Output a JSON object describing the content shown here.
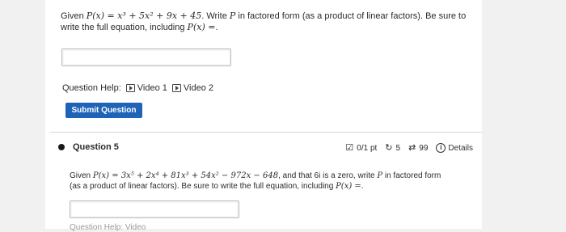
{
  "question4": {
    "line1_prefix": "Given ",
    "line1_func": "P(x)",
    "line1_eq": " = x³ + 5x² + 9x + 45",
    "line1_rest": ". Write ",
    "line1_var": "P",
    "line1_tail": " in factored form (as a product of linear factors). Be sure to",
    "line2_prefix": "write the full equation, including ",
    "line2_func": "P(x) =",
    "line2_end": ".",
    "help_label": "Question Help:",
    "video1": "Video 1",
    "video2": "Video 2",
    "submit_label": "Submit Question"
  },
  "question5": {
    "title": "Question 5",
    "score": "0/1 pt",
    "retries": "5",
    "attempts": "99",
    "details": "Details",
    "line1_prefix": "Given ",
    "line1_func": "P(x)",
    "line1_eq": " = 3x⁵ + 2x⁴ + 81x³ + 54x² − 972x − 648",
    "line1_rest": ", and that 6i is a zero, write ",
    "line1_var": "P",
    "line1_tail": " in factored form",
    "line2_prefix": "(as a product of linear factors). Be sure to write the full equation, including ",
    "line2_func": "P(x) =",
    "line2_end": ".",
    "cut_text": "Question Help:  Video"
  },
  "colors": {
    "submit_bg": "#1f63b8",
    "page_bg": "#f1f1f1"
  },
  "icons": [
    "video-icon",
    "edit-score-icon",
    "retry-icon",
    "attempts-icon",
    "info-icon"
  ]
}
